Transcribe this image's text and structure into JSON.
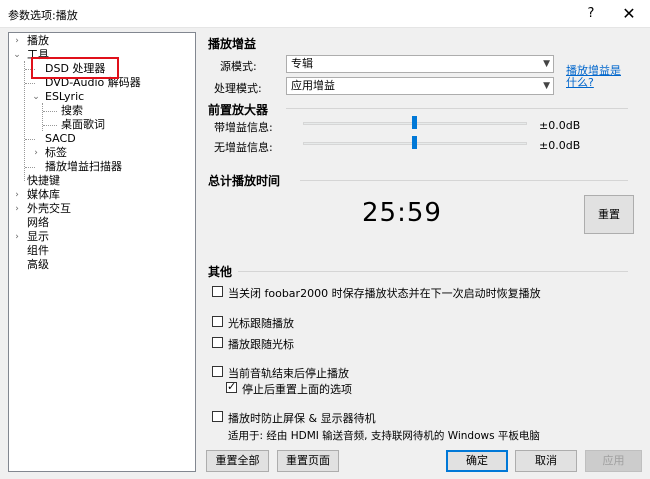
{
  "window": {
    "title": "参数选项:播放",
    "help_glyph": "?",
    "close_glyph": "✕"
  },
  "tree": {
    "items": [
      {
        "label": "播放",
        "exp": "›"
      },
      {
        "label": "工具",
        "exp": "⌄"
      },
      {
        "label": "DSD 处理器"
      },
      {
        "label": "DVD-Audio 解码器"
      },
      {
        "label": "ESLyric",
        "exp": "⌄"
      },
      {
        "label": "搜索"
      },
      {
        "label": "桌面歌词"
      },
      {
        "label": "SACD"
      },
      {
        "label": "标签",
        "exp": "›"
      },
      {
        "label": "播放增益扫描器"
      },
      {
        "label": "快捷键"
      },
      {
        "label": "媒体库",
        "exp": "›"
      },
      {
        "label": "外壳交互",
        "exp": "›"
      },
      {
        "label": "网络"
      },
      {
        "label": "显示",
        "exp": "›"
      },
      {
        "label": "组件"
      },
      {
        "label": "高级"
      }
    ]
  },
  "gain": {
    "heading": "播放增益",
    "source_label": "源模式:",
    "source_value": "专辑",
    "mode_label": "处理模式:",
    "mode_value": "应用增益",
    "link_line1": "播放增益是",
    "link_line2": "什么?"
  },
  "preamp": {
    "heading": "前置放大器",
    "with_label": "带增益信息:",
    "with_value": "±0.0dB",
    "without_label": "无增益信息:",
    "without_value": "±0.0dB"
  },
  "playtime": {
    "heading": "总计播放时间",
    "value": "25:59",
    "reset_label": "重置"
  },
  "other": {
    "heading": "其他",
    "opt_save": "当关闭 foobar2000 时保存播放状态并在下一次启动时恢复播放",
    "opt_cursor_follow": "光标跟随播放",
    "opt_playback_follow": "播放跟随光标",
    "opt_stop_after": "当前音轨结束后停止播放",
    "opt_reset_after": "停止后重置上面的选项",
    "opt_prevent_sleep": "播放时防止屏保 & 显示器待机",
    "opt_prevent_note": "适用于: 经由 HDMI 输送音频, 支持联网待机的 Windows 平板电脑"
  },
  "buttons": {
    "reset_all": "重置全部",
    "reset_page": "重置页面",
    "ok": "确定",
    "cancel": "取消",
    "apply": "应用"
  }
}
